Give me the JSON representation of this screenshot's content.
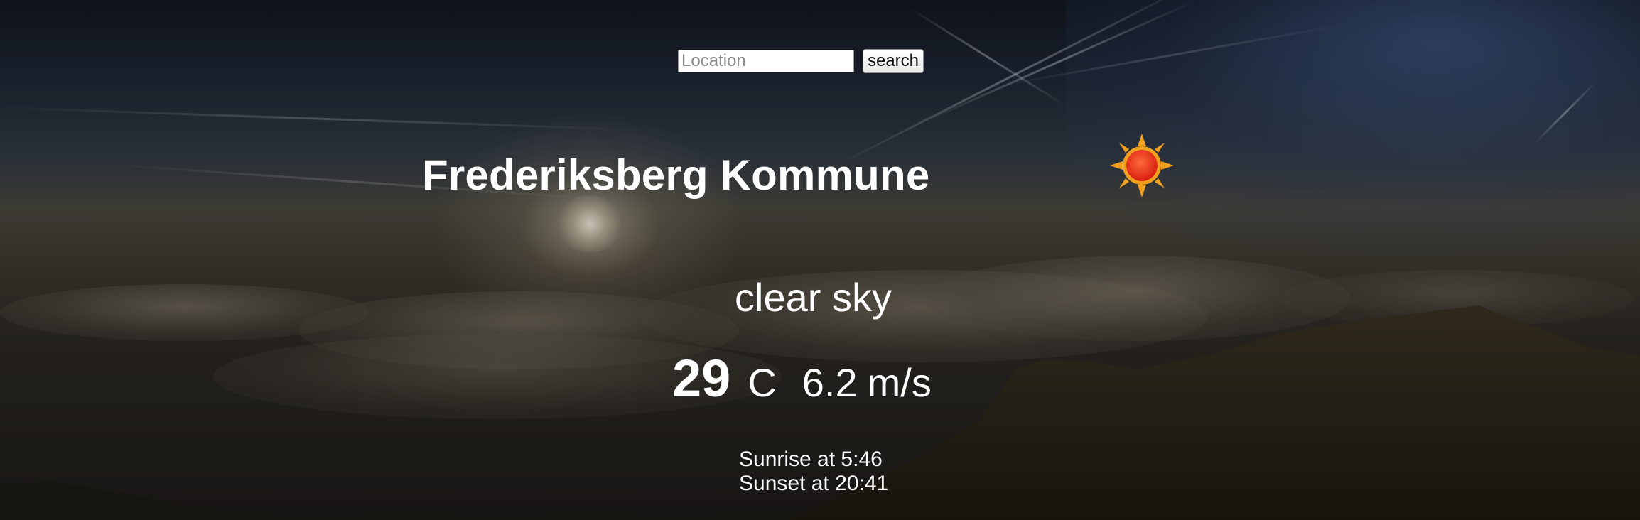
{
  "search": {
    "placeholder": "Location",
    "value": "",
    "button_label": "search"
  },
  "weather": {
    "city": "Frederiksberg Kommune",
    "icon": "sun-icon",
    "description": "clear sky",
    "temperature": "29",
    "temperature_unit": "C",
    "wind_speed": "6.2",
    "wind_unit": "m/s",
    "sunrise_label": "Sunrise at",
    "sunrise_time": "5:46",
    "sunset_label": "Sunset at",
    "sunset_time": "20:41"
  },
  "colors": {
    "text": "#ffffff",
    "sun_core": "#e8321a",
    "sun_rays": "#f2a020"
  }
}
